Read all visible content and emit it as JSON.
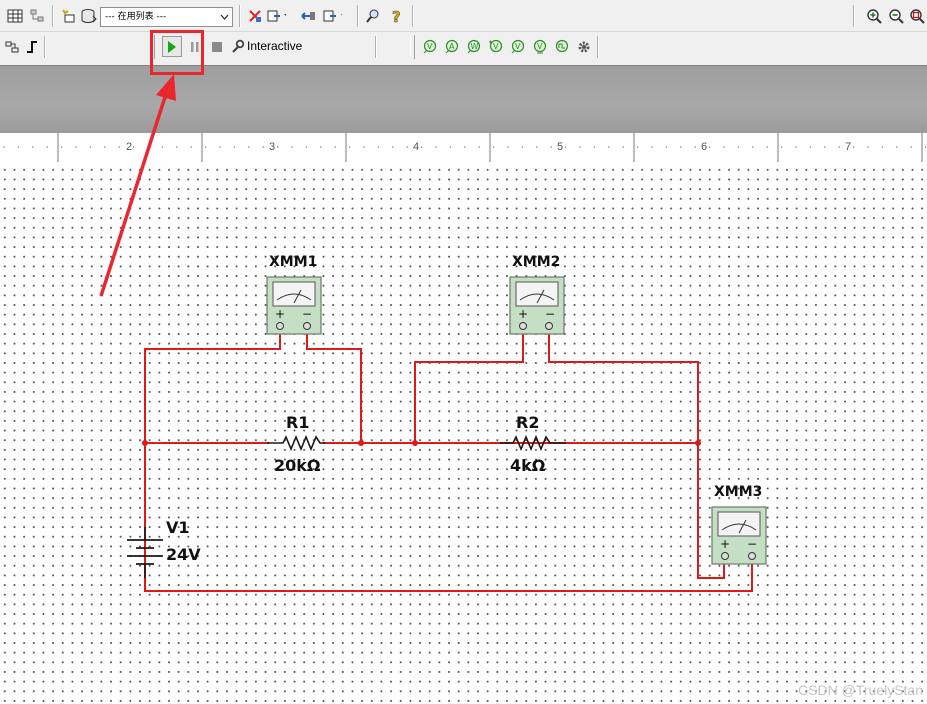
{
  "toolbar": {
    "in_use_list": "--- 在用列表 ---",
    "interactive_label": "Interactive"
  },
  "ruler": {
    "labels": [
      "2",
      "3",
      "4",
      "5",
      "6",
      "7"
    ]
  },
  "circuit": {
    "instruments": [
      {
        "ref": "XMM1",
        "plus": "+",
        "minus": "−"
      },
      {
        "ref": "XMM2",
        "plus": "+",
        "minus": "−"
      },
      {
        "ref": "XMM3",
        "plus": "+",
        "minus": "−"
      }
    ],
    "resistors": [
      {
        "ref": "R1",
        "value": "20kΩ"
      },
      {
        "ref": "R2",
        "value": "4kΩ"
      }
    ],
    "source": {
      "ref": "V1",
      "value": "24V"
    }
  },
  "watermark": "CSDN @TruelyStan",
  "colors": {
    "wire": "#e01818",
    "annotation": "#e8272e",
    "meter_face": "#c5dfc5",
    "toolbar_bg": "#f0f0f0",
    "band": "#a5a5a5"
  }
}
